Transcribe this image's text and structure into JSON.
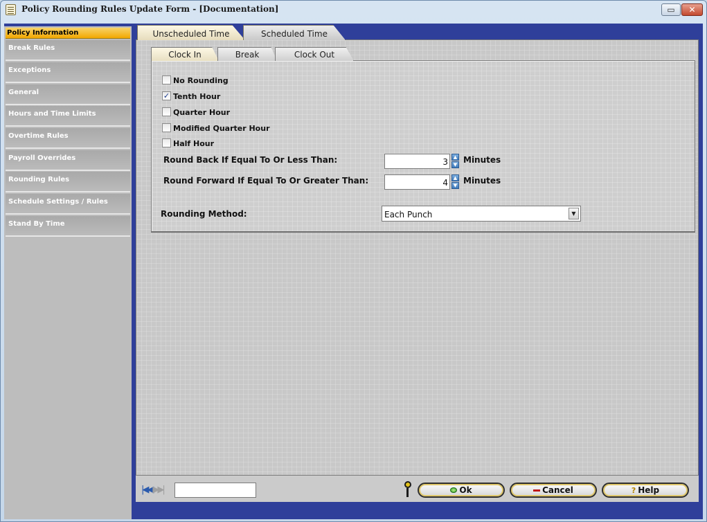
{
  "window": {
    "title": "Policy Rounding Rules Update Form - [Documentation]",
    "minimize_glyph": "▭",
    "close_glyph": "✕"
  },
  "sidebar": {
    "items": [
      {
        "label": "Policy Information",
        "active": true
      },
      {
        "label": "Break Rules",
        "active": false
      },
      {
        "label": "Exceptions",
        "active": false
      },
      {
        "label": "General",
        "active": false
      },
      {
        "label": "Hours and Time Limits",
        "active": false
      },
      {
        "label": "Overtime Rules",
        "active": false
      },
      {
        "label": "Payroll Overrides",
        "active": false
      },
      {
        "label": "Rounding Rules",
        "active": false
      },
      {
        "label": "Schedule Settings / Rules",
        "active": false
      },
      {
        "label": "Stand By Time",
        "active": false
      }
    ]
  },
  "outer_tabs": [
    {
      "label": "Unscheduled Time",
      "active": true
    },
    {
      "label": "Scheduled Time",
      "active": false
    }
  ],
  "inner_tabs": [
    {
      "label": "Clock In",
      "active": true
    },
    {
      "label": "Break",
      "active": false
    },
    {
      "label": "Clock Out",
      "active": false
    }
  ],
  "options": [
    {
      "label": "No Rounding",
      "checked": false
    },
    {
      "label": "Tenth Hour",
      "checked": true
    },
    {
      "label": "Quarter Hour",
      "checked": false
    },
    {
      "label": "Modified Quarter Hour",
      "checked": false
    },
    {
      "label": "Half Hour",
      "checked": false
    }
  ],
  "round_back": {
    "label": "Round Back If Equal To Or Less Than:",
    "value": "3",
    "unit": "Minutes"
  },
  "round_forward": {
    "label": "Round Forward If Equal To Or Greater Than:",
    "value": "4",
    "unit": "Minutes"
  },
  "rounding_method": {
    "label": "Rounding Method:",
    "value": "Each Punch"
  },
  "footer": {
    "ok_label": "Ok",
    "cancel_label": "Cancel",
    "help_label": "Help",
    "help_glyph": "?",
    "record_value": ""
  },
  "icons": {
    "check_glyph": "✓",
    "spin_up_glyph": "▲",
    "spin_down_glyph": "▼",
    "dropdown_glyph": "▼",
    "nav_first_glyph": "|◀◀",
    "nav_last_glyph": "▶▶|"
  }
}
